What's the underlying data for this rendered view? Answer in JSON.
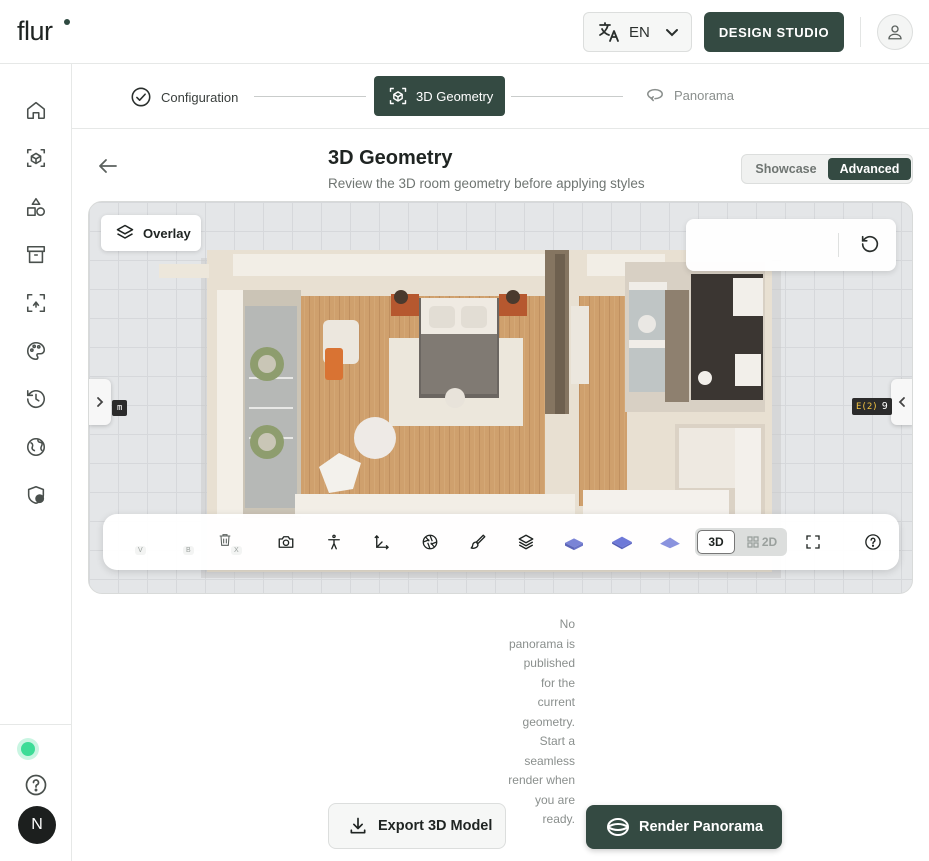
{
  "header": {
    "logo": "flur",
    "language": "EN",
    "studio_label": "DESIGN STUDIO"
  },
  "stepper": {
    "steps": [
      {
        "label": "Configuration",
        "state": "done"
      },
      {
        "label": "3D Geometry",
        "state": "active"
      },
      {
        "label": "Panorama",
        "state": "pending"
      }
    ]
  },
  "page": {
    "title": "3D Geometry",
    "subtitle": "Review the 3D room geometry before applying styles",
    "mode_options": [
      "Showcase",
      "Advanced"
    ],
    "mode_selected": "Advanced"
  },
  "viewer": {
    "overlay_label": "Overlay",
    "left_tag": "m",
    "right_tag_label": "E(2)",
    "right_tag_value": "9",
    "toolbar": {
      "kbd_v": "V",
      "kbd_b": "B",
      "kbd_x": "X",
      "view_3d": "3D",
      "view_2d": "2D",
      "view_selected": "3D"
    }
  },
  "panorama": {
    "empty_message": "No panorama is published for the current geometry. Start a seamless render when you are ready."
  },
  "actions": {
    "export_label": "Export 3D Model",
    "render_label": "Render Panorama"
  },
  "sidebar": {
    "user_initial": "N",
    "icons": [
      "home-icon",
      "cube-icon",
      "shapes-icon",
      "archive-icon",
      "scan-icon",
      "palette-icon",
      "history-icon",
      "globe-icon",
      "shield-user-icon"
    ]
  },
  "colors": {
    "brand": "#344a42",
    "status_online": "#3ddc97"
  }
}
